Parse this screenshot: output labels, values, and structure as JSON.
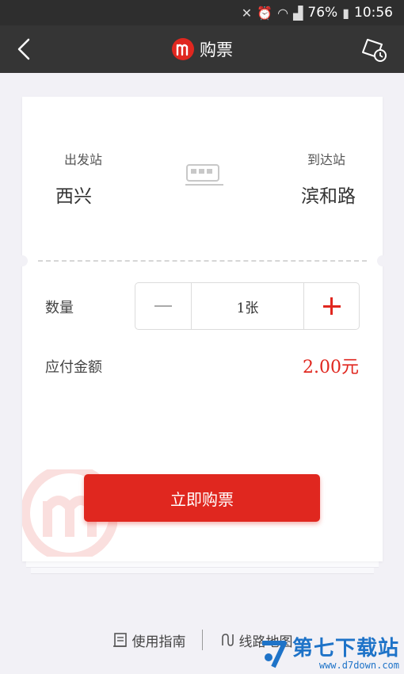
{
  "status_bar": {
    "battery": "76%",
    "time": "10:56"
  },
  "app_bar": {
    "title": "购票"
  },
  "ticket": {
    "from_label": "出发站",
    "from_station": "西兴",
    "to_label": "到达站",
    "to_station": "滨和路"
  },
  "quantity": {
    "label": "数量",
    "value": "1张"
  },
  "amount": {
    "label": "应付金额",
    "value": "2.00元"
  },
  "buy_button": {
    "label": "立即购票"
  },
  "bottom_links": {
    "guide": "使用指南",
    "map": "线路地图"
  },
  "watermark": {
    "main": "第七下载站",
    "sub": "www.d7down.com"
  },
  "colors": {
    "accent": "#e0271f",
    "header": "#353535",
    "background": "#f2f1f6"
  }
}
